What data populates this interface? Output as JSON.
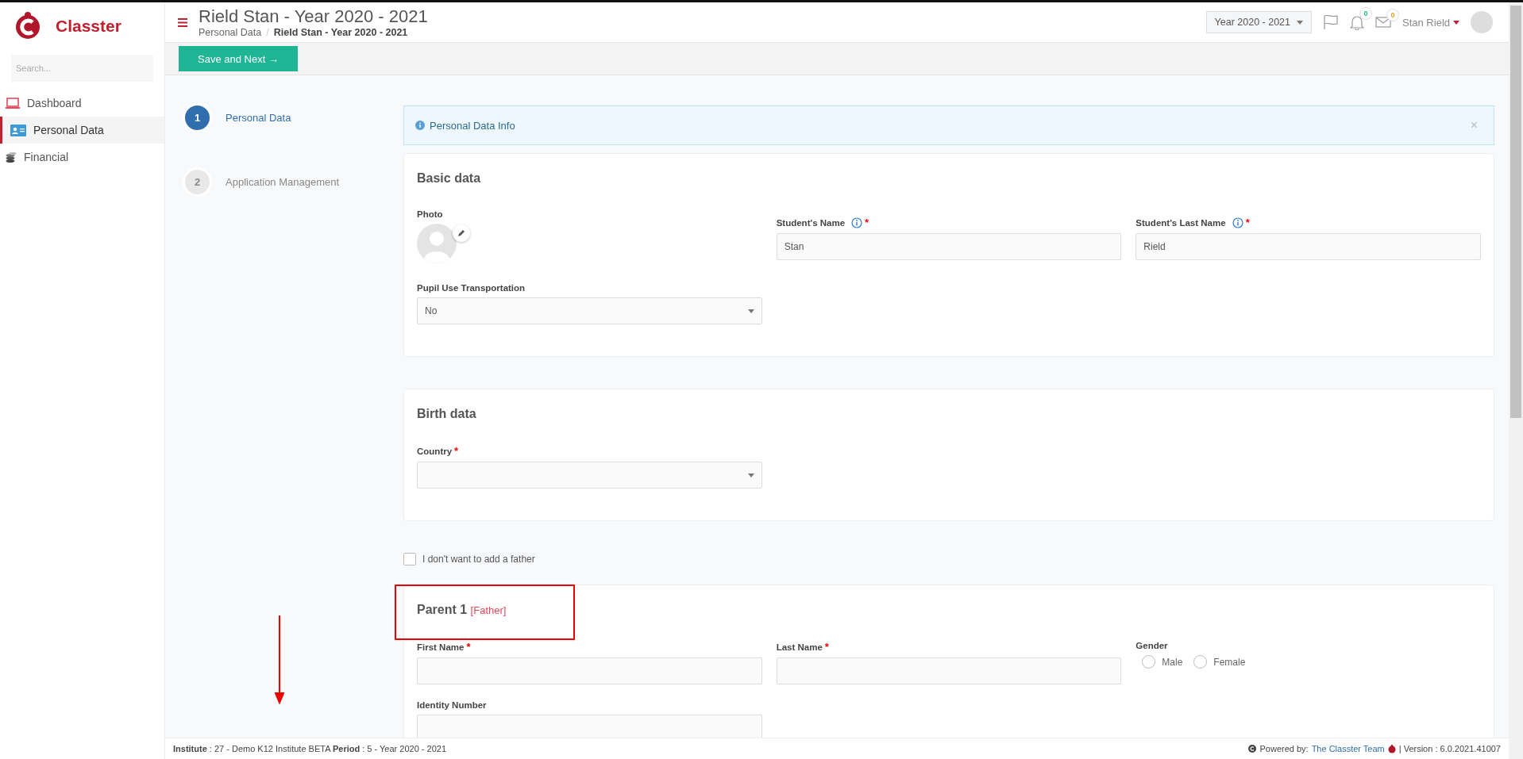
{
  "sidebar": {
    "logo_text": "Classter",
    "search": {
      "placeholder": "Search..."
    },
    "items": [
      {
        "label": "Dashboard",
        "selected": false
      },
      {
        "label": "Personal Data",
        "selected": true
      },
      {
        "label": "Financial",
        "selected": false
      }
    ]
  },
  "header": {
    "title": "Rield Stan - Year 2020 - 2021",
    "breadcrumb": [
      "Personal Data",
      "Rield Stan - Year 2020 - 2021"
    ],
    "breadcrumb_separator": "/",
    "year_select": "Year 2020 - 2021",
    "notifications": "0",
    "messages": "0",
    "user": "Stan Rield"
  },
  "toolbar": {
    "save_button": "Save and Next →"
  },
  "steps": [
    {
      "number": "1",
      "label": "Personal Data",
      "selected": true
    },
    {
      "number": "2",
      "label": "Application Management",
      "selected": false
    }
  ],
  "info": {
    "text": "Personal Data Info",
    "close": "×"
  },
  "sections": [
    {
      "title": "Basic data",
      "fields": [
        {
          "kind": "photo",
          "label": "Photo"
        },
        {
          "kind": "text",
          "label": "Student's Name",
          "required_mark": "*",
          "info": true,
          "value": "Stan"
        },
        {
          "kind": "text",
          "label": "Student's Last Name",
          "required_mark": "*",
          "info": true,
          "value": "Rield"
        },
        {
          "kind": "select",
          "label": "Pupil Use Transportation",
          "value": "No"
        }
      ]
    },
    {
      "title": "Birth data",
      "fields": [
        {
          "kind": "select",
          "label": "Country",
          "required_mark": "*"
        }
      ]
    }
  ],
  "father_opt_out": {
    "label": "I don't want to add a father",
    "checked": false
  },
  "parent": {
    "title": "Parent 1",
    "tag": "[Father]",
    "fields": [
      {
        "kind": "text",
        "label": "First Name",
        "required_mark": "*"
      },
      {
        "kind": "text",
        "label": "Last Name",
        "required_mark": "*"
      },
      {
        "kind": "radio",
        "label": "Gender",
        "options": [
          {
            "label": "Male",
            "selected": false
          },
          {
            "label": "Female",
            "selected": false
          }
        ]
      },
      {
        "kind": "text",
        "label": "Identity Number"
      }
    ]
  },
  "footer": {
    "info": "**Institute** : 27 - Demo K12 Institute BETA **Period** : 5 - Year 2020 - 2021",
    "powered": "Powered by:",
    "team_link": "The Classter Team",
    "version": "| Version : 6.0.2021.41007"
  }
}
